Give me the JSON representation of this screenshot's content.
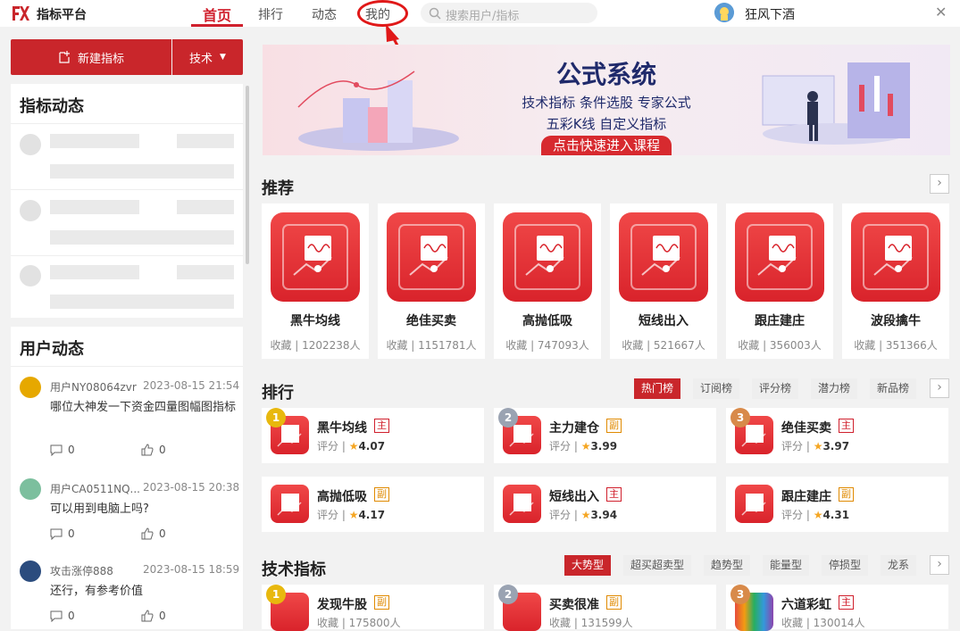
{
  "app": {
    "title": "指标平台"
  },
  "nav": {
    "tabs": [
      "首页",
      "排行",
      "动态",
      "我的"
    ]
  },
  "search": {
    "placeholder": "搜索用户/指标"
  },
  "user": {
    "name": "狂风下酒"
  },
  "sidebar": {
    "new_button": "新建指标",
    "tech_button": "技术",
    "indicator_feed_title": "指标动态",
    "user_feed_title": "用户动态",
    "posts": [
      {
        "user": "用户NY08064zvr",
        "time": "2023-08-15 21:54",
        "text": "哪位大神发一下资金四量图幅图指标",
        "comments": "0",
        "likes": "0",
        "avatar_color": "#e6a800"
      },
      {
        "user": "用户CA0511NQ...",
        "time": "2023-08-15 20:38",
        "text": "可以用到电脑上吗?",
        "comments": "0",
        "likes": "0",
        "avatar_color": "#7cbf9e"
      },
      {
        "user": "攻击涨停888",
        "time": "2023-08-15 18:59",
        "text": "还行，有参考价值",
        "comments": "0",
        "likes": "0",
        "avatar_color": "#2b4c7e"
      }
    ]
  },
  "banner": {
    "title": "公式系统",
    "line1": "技术指标  条件选股  专家公式",
    "line2": "五彩K线  自定义指标",
    "cta": "点击快速进入课程"
  },
  "recommend": {
    "title": "推荐",
    "items": [
      {
        "name": "黑牛均线",
        "favs": "收藏 | 1202238人"
      },
      {
        "name": "绝佳买卖",
        "favs": "收藏 | 1151781人"
      },
      {
        "name": "高抛低吸",
        "favs": "收藏 | 747093人"
      },
      {
        "name": "短线出入",
        "favs": "收藏 | 521667人"
      },
      {
        "name": "跟庄建庄",
        "favs": "收藏 | 356003人"
      },
      {
        "name": "波段擒牛",
        "favs": "收藏 | 351366人"
      }
    ]
  },
  "ranking": {
    "title": "排行",
    "tabs": [
      "热门榜",
      "订阅榜",
      "评分榜",
      "潜力榜",
      "新品榜"
    ],
    "items": [
      {
        "rank": "1",
        "name": "黑牛均线",
        "badge": "主",
        "score_label": "评分 |",
        "score": "4.07"
      },
      {
        "rank": "2",
        "name": "主力建仓",
        "badge": "副",
        "score_label": "评分 |",
        "score": "3.99"
      },
      {
        "rank": "3",
        "name": "绝佳买卖",
        "badge": "主",
        "score_label": "评分 |",
        "score": "3.97"
      },
      {
        "rank": "",
        "name": "高抛低吸",
        "badge": "副",
        "score_label": "评分 |",
        "score": "4.17"
      },
      {
        "rank": "",
        "name": "短线出入",
        "badge": "主",
        "score_label": "评分 |",
        "score": "3.94"
      },
      {
        "rank": "",
        "name": "跟庄建庄",
        "badge": "副",
        "score_label": "评分 |",
        "score": "4.31"
      }
    ]
  },
  "tech": {
    "title": "技术指标",
    "tabs": [
      "大势型",
      "超买超卖型",
      "趋势型",
      "能量型",
      "停损型",
      "龙系"
    ],
    "items": [
      {
        "rank": "1",
        "name": "发现牛股",
        "badge": "副",
        "favs": "收藏 | 175800人"
      },
      {
        "rank": "2",
        "name": "买卖很准",
        "badge": "副",
        "favs": "收藏 | 131599人"
      },
      {
        "rank": "3",
        "name": "六道彩虹",
        "badge": "主",
        "favs": "收藏 | 130014人"
      }
    ]
  },
  "colors": {
    "accent": "#c9262b",
    "main_badge": "#d0202d",
    "sub_badge": "#e08a00",
    "annotation": "#e01818"
  }
}
